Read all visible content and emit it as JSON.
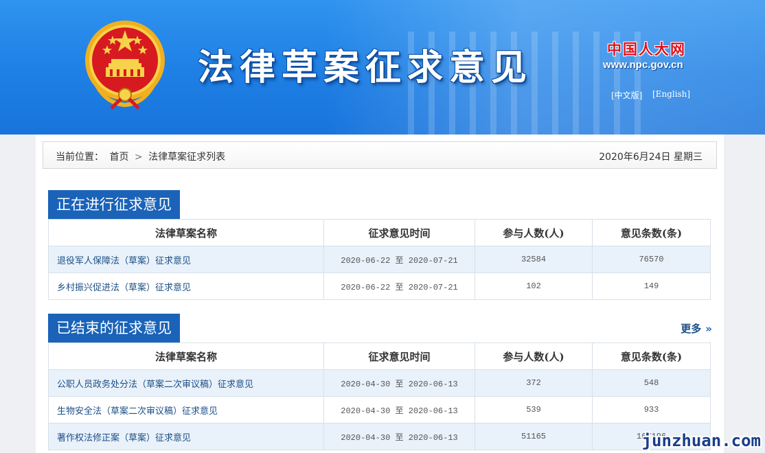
{
  "banner": {
    "title": "法律草案征求意见",
    "npc_logo": "中国人大网",
    "npc_url": "www.npc.gov.cn",
    "lang_cn": "[中文版]",
    "lang_en": "[English]"
  },
  "breadcrumb": {
    "label": "当前位置：",
    "home": "首页",
    "separator": ">",
    "current": "法律草案征求列表",
    "date": "2020年6月24日 星期三"
  },
  "ongoing": {
    "heading": "正在进行征求意见",
    "columns": [
      "法律草案名称",
      "征求意见时间",
      "参与人数(人)",
      "意见条数(条)"
    ],
    "rows": [
      {
        "name": "退役军人保障法（草案）征求意见",
        "start": "2020-06-22",
        "to": "至",
        "end": "2020-07-21",
        "people": "32584",
        "comments": "76570"
      },
      {
        "name": "乡村振兴促进法（草案）征求意见",
        "start": "2020-06-22",
        "to": "至",
        "end": "2020-07-21",
        "people": "102",
        "comments": "149"
      }
    ]
  },
  "finished": {
    "heading": "已结束的征求意见",
    "more": "更多",
    "more_arrow": "»",
    "columns": [
      "法律草案名称",
      "征求意见时间",
      "参与人数(人)",
      "意见条数(条)"
    ],
    "rows": [
      {
        "name": "公职人员政务处分法（草案二次审议稿）征求意见",
        "start": "2020-04-30",
        "to": "至",
        "end": "2020-06-13",
        "people": "372",
        "comments": "548"
      },
      {
        "name": "生物安全法（草案二次审议稿）征求意见",
        "start": "2020-04-30",
        "to": "至",
        "end": "2020-06-13",
        "people": "539",
        "comments": "933"
      },
      {
        "name": "著作权法修正案（草案）征求意见",
        "start": "2020-04-30",
        "to": "至",
        "end": "2020-06-13",
        "people": "51165",
        "comments": "167196"
      }
    ]
  },
  "watermark": "junzhuan.com",
  "colors": {
    "banner_blue": "#1e7fe4",
    "section_blue": "#1a63b8",
    "row_stripe": "#e9f1fa",
    "link_blue": "#1b4e86",
    "logo_red": "#e1101c"
  }
}
